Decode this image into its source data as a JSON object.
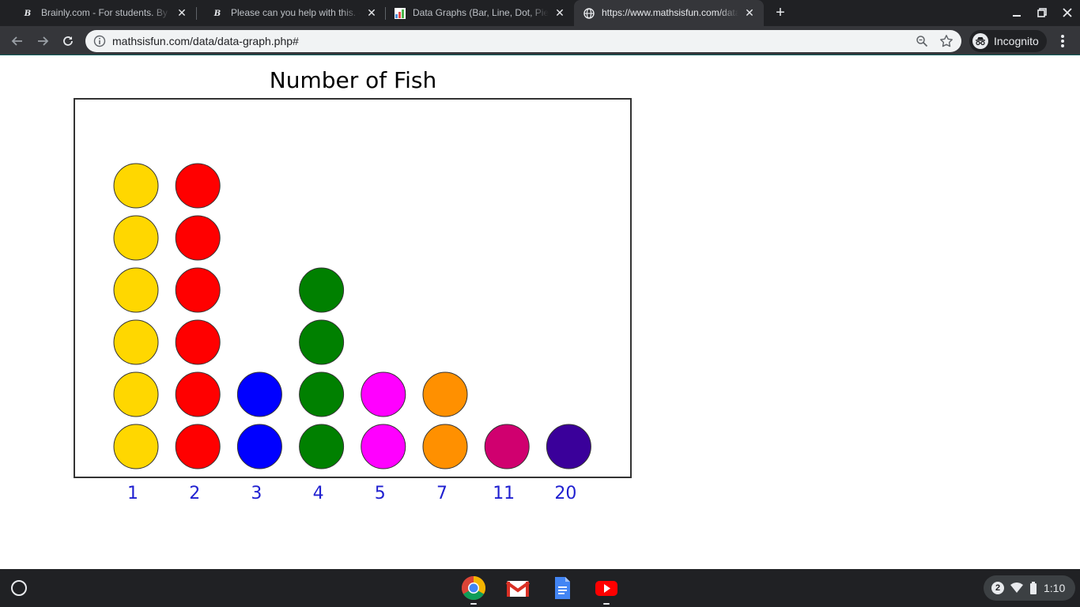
{
  "browser": {
    "tabs": [
      {
        "title": "Brainly.com - For students. By st",
        "favicon": "brainly-icon",
        "active": false
      },
      {
        "title": "Please can you help with this. - B",
        "favicon": "brainly-icon",
        "active": false
      },
      {
        "title": "Data Graphs (Bar, Line, Dot, Pie, F",
        "favicon": "mathsisfun-icon",
        "active": false
      },
      {
        "title": "https://www.mathsisfun.com/data",
        "favicon": "globe-icon",
        "active": true
      }
    ],
    "address": "mathsisfun.com/data/data-graph.php#",
    "incognito_label": "Incognito"
  },
  "chart_data": {
    "type": "dot",
    "title": "Number of Fish",
    "categories": [
      "1",
      "2",
      "3",
      "4",
      "5",
      "7",
      "11",
      "20"
    ],
    "values": [
      6,
      6,
      2,
      4,
      2,
      2,
      1,
      1
    ],
    "colors": [
      "#ffd700",
      "#ff0000",
      "#0000ff",
      "#008000",
      "#ff00ff",
      "#ff9000",
      "#d0006f",
      "#3a009a"
    ],
    "xlabel": "",
    "ylabel": "",
    "ylim": [
      0,
      7
    ]
  },
  "shelf": {
    "apps": [
      "chrome-icon",
      "gmail-icon",
      "docs-icon",
      "youtube-icon"
    ],
    "notification_count": "2",
    "time": "1:10"
  }
}
